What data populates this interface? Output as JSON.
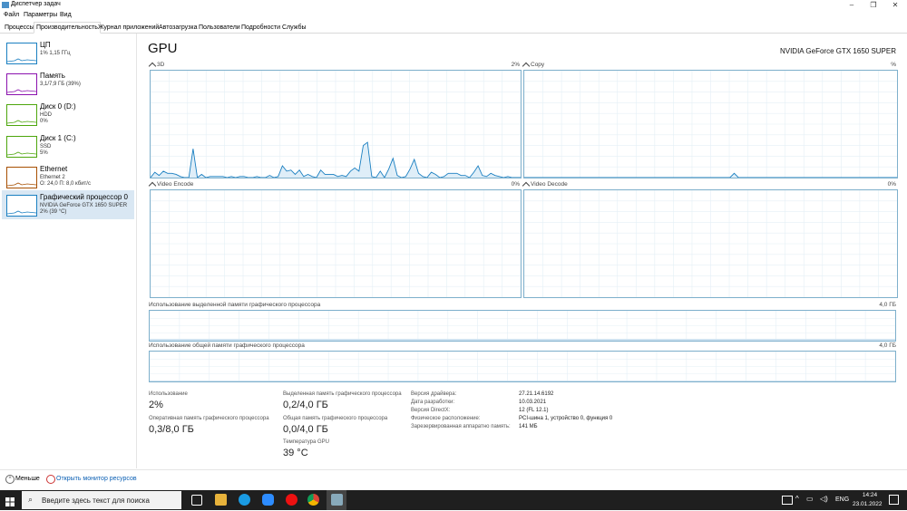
{
  "window": {
    "title": "Диспетчер задач"
  },
  "menu": [
    "Файл",
    "Параметры",
    "Вид"
  ],
  "tabs": [
    "Процессы",
    "Производительность",
    "Журнал приложений",
    "Автозагрузка",
    "Пользователи",
    "Подробности",
    "Службы"
  ],
  "active_tab": 1,
  "sidebar": {
    "items": [
      {
        "name": "ЦП",
        "sub1": "1% 1,15 ГГц",
        "sub2": "",
        "color": "#1a7fc1"
      },
      {
        "name": "Память",
        "sub1": "3,1/7,9 ГБ (39%)",
        "sub2": "",
        "color": "#8b12ae"
      },
      {
        "name": "Диск 0 (D:)",
        "sub1": "HDD",
        "sub2": "0%",
        "color": "#4da60c"
      },
      {
        "name": "Диск 1 (C:)",
        "sub1": "SSD",
        "sub2": "5%",
        "color": "#4da60c"
      },
      {
        "name": "Ethernet",
        "sub1": "Ethernet 2",
        "sub2": "О: 24,0  П: 8,0 кбит/с",
        "color": "#a74f01"
      },
      {
        "name": "Графический процессор 0",
        "sub1": "NVIDIA GeForce GTX 1650 SUPER",
        "sub2": "2% (39 °C)",
        "color": "#1a7fc1"
      }
    ]
  },
  "gpu": {
    "title": "GPU",
    "model": "NVIDIA GeForce GTX 1650 SUPER",
    "engines": [
      {
        "name": "3D",
        "percent": "2%",
        "utilization": [
          0,
          5,
          2,
          6,
          4,
          4,
          3,
          1,
          0,
          0,
          27,
          0,
          3,
          0,
          1,
          1,
          1,
          1,
          0,
          1,
          0,
          1,
          1,
          0,
          0,
          1,
          0,
          0,
          2,
          0,
          1,
          11,
          6,
          7,
          3,
          7,
          1,
          3,
          1,
          0,
          7,
          3,
          3,
          3,
          1,
          2,
          1,
          6,
          9,
          6,
          30,
          33,
          1,
          0,
          6,
          0,
          8,
          18,
          2,
          0,
          1,
          8,
          17,
          4,
          1,
          0,
          5,
          3,
          0,
          1,
          4,
          4,
          4,
          2,
          2,
          0,
          5,
          11,
          2,
          1,
          4,
          2,
          1,
          0,
          1,
          0,
          0,
          0
        ]
      },
      {
        "name": "Copy",
        "percent": "%",
        "utilization": [
          0,
          0,
          0,
          0,
          0,
          0,
          0,
          0,
          0,
          0,
          0,
          0,
          0,
          0,
          0,
          0,
          0,
          0,
          0,
          0,
          0,
          0,
          0,
          0,
          0,
          0,
          0,
          0,
          0,
          0,
          0,
          0,
          0,
          0,
          0,
          0,
          0,
          0,
          0,
          0,
          0,
          0,
          0,
          0,
          0,
          0,
          0,
          0,
          0,
          4,
          0,
          0,
          0,
          0,
          0,
          0,
          0,
          0,
          0,
          0,
          0,
          0,
          0,
          0,
          0,
          0,
          0,
          0,
          0,
          0,
          0,
          0,
          0,
          0,
          0,
          0,
          0,
          0,
          0,
          0,
          0,
          0,
          0,
          0,
          0,
          0,
          0,
          0
        ]
      },
      {
        "name": "Video Encode",
        "percent": "0%",
        "utilization": []
      },
      {
        "name": "Video Decode",
        "percent": "0%",
        "utilization": []
      }
    ],
    "dedicated_mem_label": "Использование выделенной памяти графического процессора",
    "dedicated_mem_max": "4,0 ГБ",
    "shared_mem_label": "Использование общей памяти графического процессора",
    "shared_mem_max": "4,0 ГБ",
    "stats": {
      "usage_label": "Использование",
      "usage_value": "2%",
      "gpu_mem_label": "Оперативная память графического процессора",
      "gpu_mem_value": "0,3/8,0 ГБ",
      "dedicated_label": "Выделенная память графического процессора",
      "dedicated_value": "0,2/4,0 ГБ",
      "shared_label": "Общая память графического процессора",
      "shared_value": "0,0/4,0 ГБ",
      "temp_label": "Температура GPU",
      "temp_value": "39 °C"
    },
    "details": [
      {
        "key": "Версия драйвера:",
        "value": "27.21.14.6192"
      },
      {
        "key": "Дата разработки:",
        "value": "10.03.2021"
      },
      {
        "key": "Версия DirectX:",
        "value": "12 (FL 12.1)"
      },
      {
        "key": "Физическое расположение:",
        "value": "PCI-шина 1, устройство 0, функция 0"
      },
      {
        "key": "Зарезервированная аппаратно память:",
        "value": "141 МБ"
      }
    ]
  },
  "footer": {
    "less_label": "Меньше",
    "monitor_link": "Открыть монитор ресурсов"
  },
  "taskbar": {
    "search_placeholder": "Введите здесь текст для поиска",
    "lang": "ENG",
    "time": "14:24",
    "date": "23.01.2022"
  },
  "colors": {
    "graph_line": "#1a7fc1",
    "graph_border": "#7fb0cc",
    "selected": "#d9e7f3",
    "taskbar": "#1f1f1f"
  }
}
